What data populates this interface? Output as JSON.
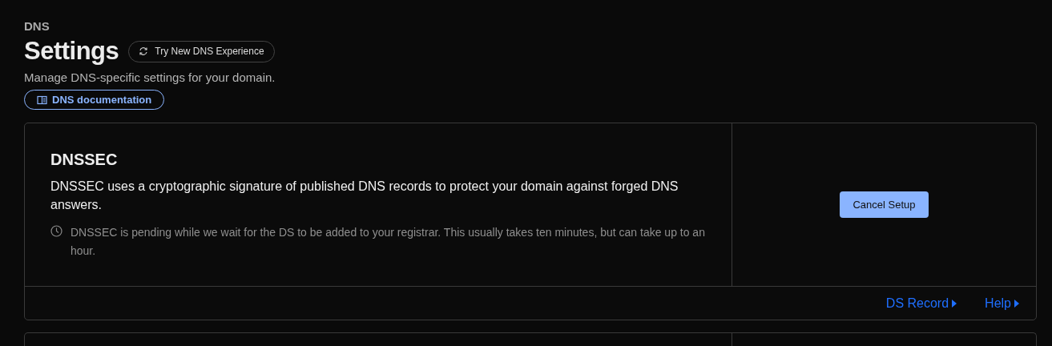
{
  "breadcrumb": "DNS",
  "title": "Settings",
  "experience_button": {
    "label": "Try New DNS Experience"
  },
  "description": "Manage DNS-specific settings for your domain.",
  "docs_link": {
    "label": "DNS documentation"
  },
  "dnssec_card": {
    "title": "DNSSEC",
    "description": "DNSSEC uses a cryptographic signature of published DNS records to protect your domain against forged DNS answers.",
    "note": "DNSSEC is pending while we wait for the DS to be added to your registrar. This usually takes ten minutes, but can take up to an hour.",
    "action": {
      "label": "Cancel Setup"
    },
    "footer_links": [
      {
        "label": "DS Record"
      },
      {
        "label": "Help"
      }
    ]
  }
}
